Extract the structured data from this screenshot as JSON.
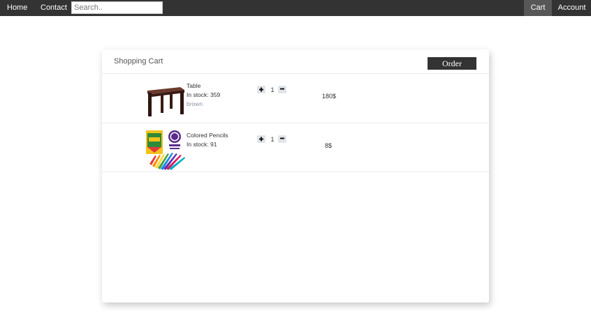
{
  "nav": {
    "home_label": "Home",
    "contact_label": "Contact",
    "search_placeholder": "Search..",
    "cart_label": "Cart",
    "account_label": "Account"
  },
  "cart": {
    "title": "Shopping Cart",
    "order_label": "Order",
    "items": [
      {
        "name": "Table",
        "stock": "In stock: 359",
        "color": "brown",
        "quantity": "1",
        "price": "180$",
        "image_icon": "wooden-table-image"
      },
      {
        "name": "Colored Pencils",
        "stock": "In stock: 91",
        "quantity": "1",
        "price": "8$",
        "image_icon": "colored-pencils-box-image"
      }
    ]
  },
  "colors": {
    "nav_background": "#333333",
    "nav_active": "#575757",
    "button_dark": "#333333",
    "quantity_button": "#e1e5ea",
    "muted_text": "#8b94a5"
  }
}
